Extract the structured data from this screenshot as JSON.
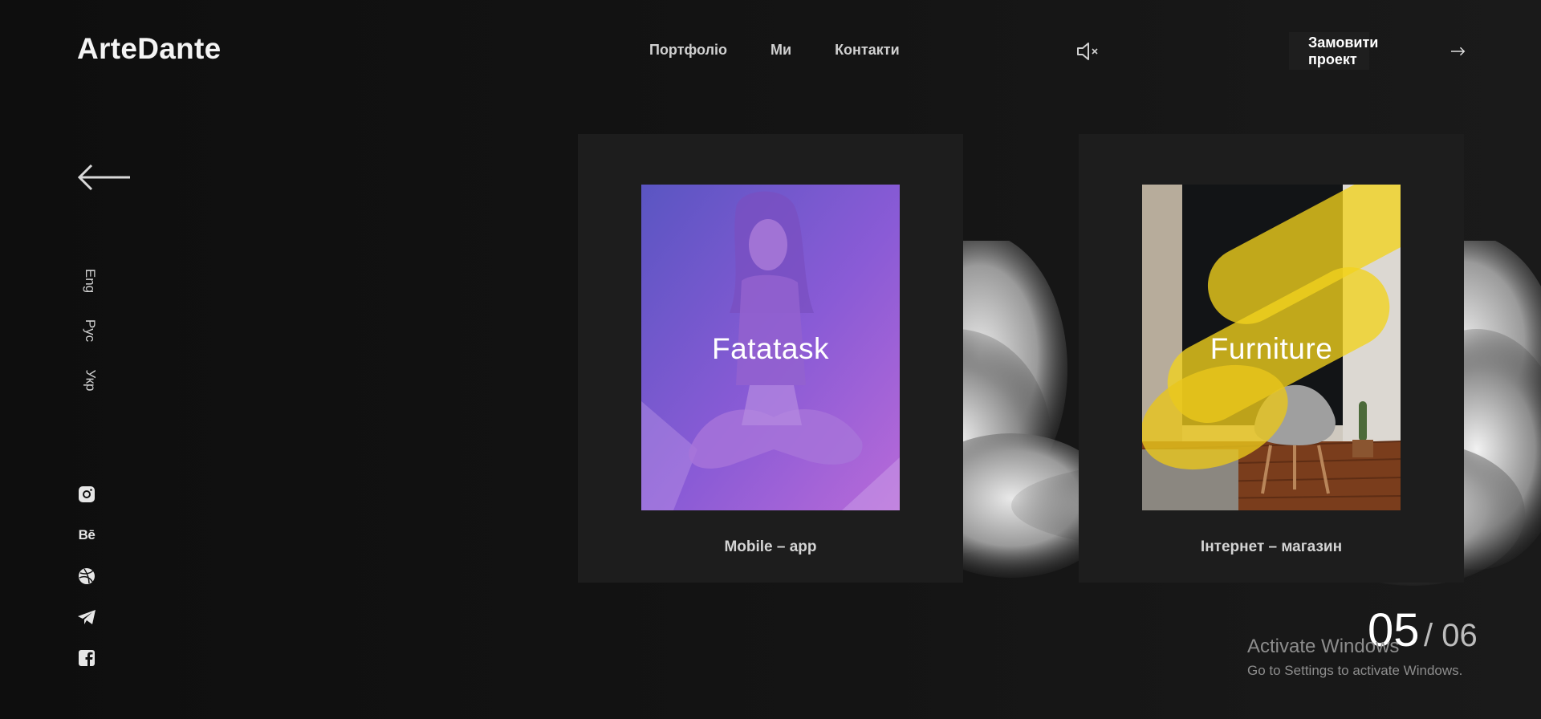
{
  "header": {
    "logo": "ArteDante",
    "nav": [
      "Портфоліо",
      "Ми",
      "Контакти"
    ],
    "sound_icon": "speaker-muted-icon",
    "order_button": "Замовити проект"
  },
  "sidebar": {
    "languages": [
      "Eng",
      "Рус",
      "Укр"
    ],
    "socials": [
      "instagram-icon",
      "behance-icon",
      "dribbble-icon",
      "telegram-icon",
      "facebook-icon"
    ],
    "behance_glyph": "Bē"
  },
  "slider": {
    "prev_icon": "arrow-left-icon",
    "next_icon": "arrow-right-icon",
    "cards": [
      {
        "title": "Fatatask",
        "caption": "Mobile – app",
        "accent": "#8a5bd6"
      },
      {
        "title": "Furniture",
        "caption": "Інтернет – магазин",
        "accent": "#f2d21e"
      }
    ],
    "current": "05",
    "total": "/ 06"
  },
  "watermark": {
    "title": "Activate Windows",
    "subtitle": "Go to Settings to activate Windows."
  },
  "colors": {
    "background": "#111111",
    "card": "#1d1d1d",
    "text": "#ffffff"
  }
}
